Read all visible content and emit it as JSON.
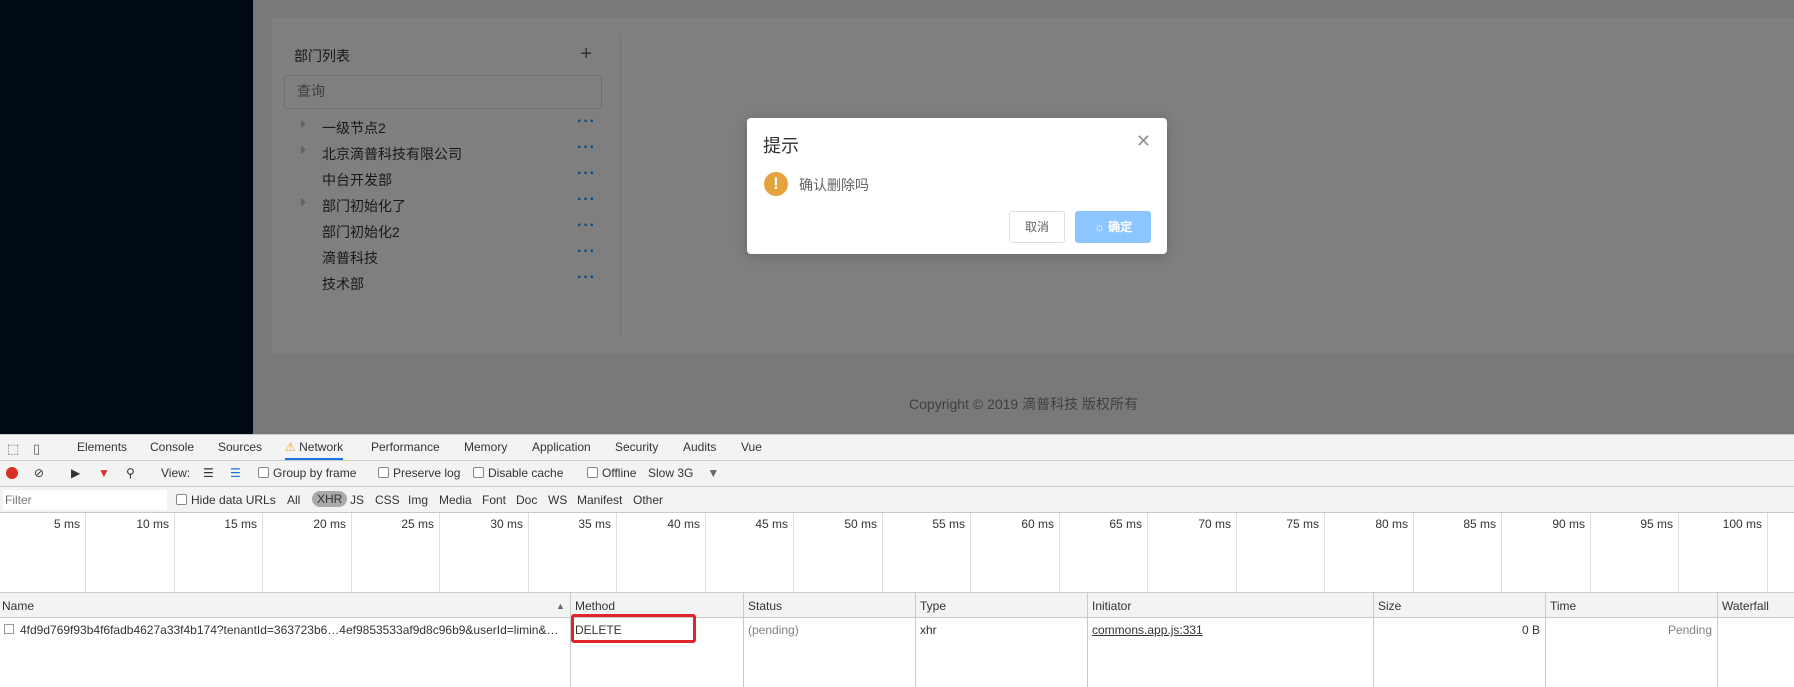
{
  "app": {
    "tree": {
      "title": "部门列表",
      "add_icon": "plus-icon",
      "search_placeholder": "查询",
      "items": [
        {
          "label": "一级节点2",
          "expandable": true
        },
        {
          "label": "北京滴普科技有限公司",
          "expandable": true
        },
        {
          "label": "中台开发部",
          "expandable": false
        },
        {
          "label": "部门初始化了",
          "expandable": true
        },
        {
          "label": "部门初始化2",
          "expandable": false
        },
        {
          "label": "滴普科技",
          "expandable": false
        },
        {
          "label": "技术部",
          "expandable": false
        }
      ],
      "more_label": "···"
    },
    "footer": "Copyright © 2019 滴普科技 版权所有"
  },
  "dialog": {
    "title": "提示",
    "message": "确认删除吗",
    "cancel_label": "取消",
    "ok_label": "确定",
    "ok_loading": true
  },
  "devtools": {
    "tabs": [
      "Elements",
      "Console",
      "Sources",
      "Network",
      "Performance",
      "Memory",
      "Application",
      "Security",
      "Audits",
      "Vue"
    ],
    "active_tab": "Network",
    "toolbar": {
      "view_label": "View:",
      "group_by_frame": "Group by frame",
      "preserve_log": "Preserve log",
      "disable_cache": "Disable cache",
      "offline": "Offline",
      "throttle": "Slow 3G"
    },
    "filter": {
      "placeholder": "Filter",
      "hide_data_urls": "Hide data URLs",
      "types": [
        "All",
        "XHR",
        "JS",
        "CSS",
        "Img",
        "Media",
        "Font",
        "Doc",
        "WS",
        "Manifest",
        "Other"
      ],
      "active_type": "XHR"
    },
    "timeline_ticks": [
      "5 ms",
      "10 ms",
      "15 ms",
      "20 ms",
      "25 ms",
      "30 ms",
      "35 ms",
      "40 ms",
      "45 ms",
      "50 ms",
      "55 ms",
      "60 ms",
      "65 ms",
      "70 ms",
      "75 ms",
      "80 ms",
      "85 ms",
      "90 ms",
      "95 ms",
      "100 ms"
    ],
    "columns": [
      "Name",
      "Method",
      "Status",
      "Type",
      "Initiator",
      "Size",
      "Time",
      "Waterfall"
    ],
    "rows": [
      {
        "name": "4fd9d769f93b4f6fadb4627a33f4b174?tenantId=363723b6…4ef9853533af9d8c96b9&userId=limin&…",
        "method": "DELETE",
        "status": "(pending)",
        "type": "xhr",
        "initiator": "commons.app.js:331",
        "size": "0 B",
        "time": "Pending"
      }
    ]
  }
}
